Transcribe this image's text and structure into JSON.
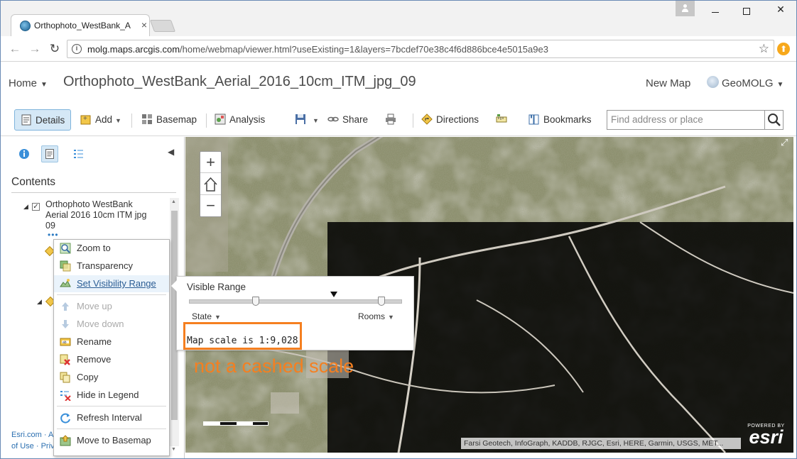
{
  "browser": {
    "tab_title": "Orthophoto_WestBank_A",
    "url_domain": "molg.maps.arcgis.com",
    "url_path": "/home/webmap/viewer.html?useExisting=1&layers=7bcdef70e38c4f6d886bce4e5015a9e3"
  },
  "app": {
    "home_label": "Home",
    "map_title": "Orthophoto_WestBank_Aerial_2016_10cm_ITM_jpg_09",
    "new_map_label": "New Map",
    "user_label": "GeoMOLG"
  },
  "toolbar": {
    "details": "Details",
    "add": "Add",
    "basemap": "Basemap",
    "analysis": "Analysis",
    "share": "Share",
    "directions": "Directions",
    "bookmarks": "Bookmarks",
    "search_placeholder": "Find address or place"
  },
  "sidebar": {
    "contents_heading": "Contents",
    "layer_name": "Orthophoto WestBank Aerial 2016 10cm ITM jpg 09",
    "footer_line1": "Esri.com · A",
    "footer_line2": "of Use · Priv"
  },
  "context_menu": [
    {
      "label": "Zoom to",
      "enabled": true
    },
    {
      "label": "Transparency",
      "enabled": true
    },
    {
      "label": "Set Visibility Range",
      "enabled": true
    },
    {
      "label": "Move up",
      "enabled": false
    },
    {
      "label": "Move down",
      "enabled": false
    },
    {
      "label": "Rename",
      "enabled": true
    },
    {
      "label": "Remove",
      "enabled": true
    },
    {
      "label": "Copy",
      "enabled": true
    },
    {
      "label": "Hide in Legend",
      "enabled": true
    },
    {
      "label": "Refresh Interval",
      "enabled": true
    },
    {
      "label": "Move to Basemap",
      "enabled": true
    }
  ],
  "visibility_popup": {
    "title": "Visible Range",
    "min_label": "State",
    "max_label": "Rooms",
    "scale_text": "Map scale is 1:9,028"
  },
  "annotation": "not a cashed scale",
  "map": {
    "attribution": "Farsi Geotech, InfoGraph, KADDB, RJGC, Esri, HERE, Garmin, USGS, MET...",
    "powered_by": "POWERED BY",
    "esri_logo": "esri"
  },
  "colors": {
    "accent_orange": "#f57f20",
    "selected_blue": "#d5e8f6",
    "link_blue": "#2b6fb0"
  }
}
